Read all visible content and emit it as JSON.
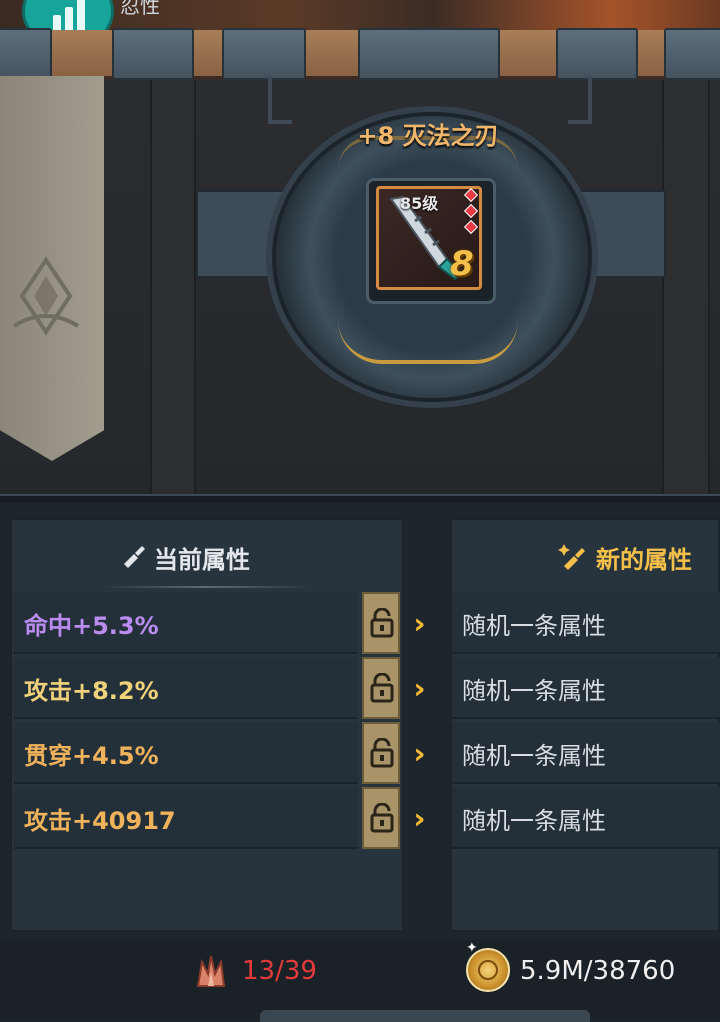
{
  "top": {
    "label": "忍性"
  },
  "item": {
    "name": "+8 灭法之刃",
    "level": "85级",
    "enhance": "8"
  },
  "current": {
    "title": "当前属性",
    "attrs": [
      {
        "text": "命中+5.3%",
        "color": "#b98cf0"
      },
      {
        "text": "攻击+8.2%",
        "color": "#f0d27a"
      },
      {
        "text": "贯穿+4.5%",
        "color": "#f0b25a"
      },
      {
        "text": "攻击+40917",
        "color": "#f0b25a"
      }
    ]
  },
  "new": {
    "title": "新的属性",
    "rows": [
      "随机一条属性",
      "随机一条属性",
      "随机一条属性",
      "随机一条属性"
    ]
  },
  "footer": {
    "crystal_count": "13/39",
    "gold": "5.9M/38760"
  }
}
